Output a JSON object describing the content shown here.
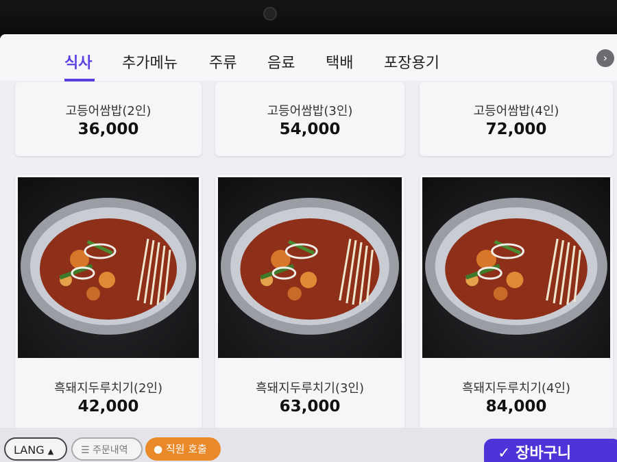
{
  "tabs": [
    {
      "label": "식사",
      "active": true
    },
    {
      "label": "추가메뉴"
    },
    {
      "label": "주류"
    },
    {
      "label": "음료"
    },
    {
      "label": "택배"
    },
    {
      "label": "포장용기"
    }
  ],
  "menu": {
    "top_row": [
      {
        "name": "고등어쌈밥(2인)",
        "price": "36,000"
      },
      {
        "name": "고등어쌈밥(3인)",
        "price": "54,000"
      },
      {
        "name": "고등어쌈밥(4인)",
        "price": "72,000"
      }
    ],
    "bottom_row": [
      {
        "name": "흑돼지두루치기(2인)",
        "price": "42,000"
      },
      {
        "name": "흑돼지두루치기(3인)",
        "price": "63,000"
      },
      {
        "name": "흑돼지두루치기(4인)",
        "price": "84,000"
      }
    ]
  },
  "bottom_bar": {
    "lang_label": "LANG",
    "lang_arrow": "▲",
    "history_label": "주문내역",
    "staff_label": "직원 호출",
    "cart_label": "장바구니"
  },
  "colors": {
    "accent": "#5a3ee0",
    "staff_button": "#e9892a",
    "cart_button": "#4d34d8"
  },
  "icons": {
    "next": "chevron-right-icon",
    "history": "list-icon",
    "staff": "person-icon",
    "cart": "check-icon"
  }
}
